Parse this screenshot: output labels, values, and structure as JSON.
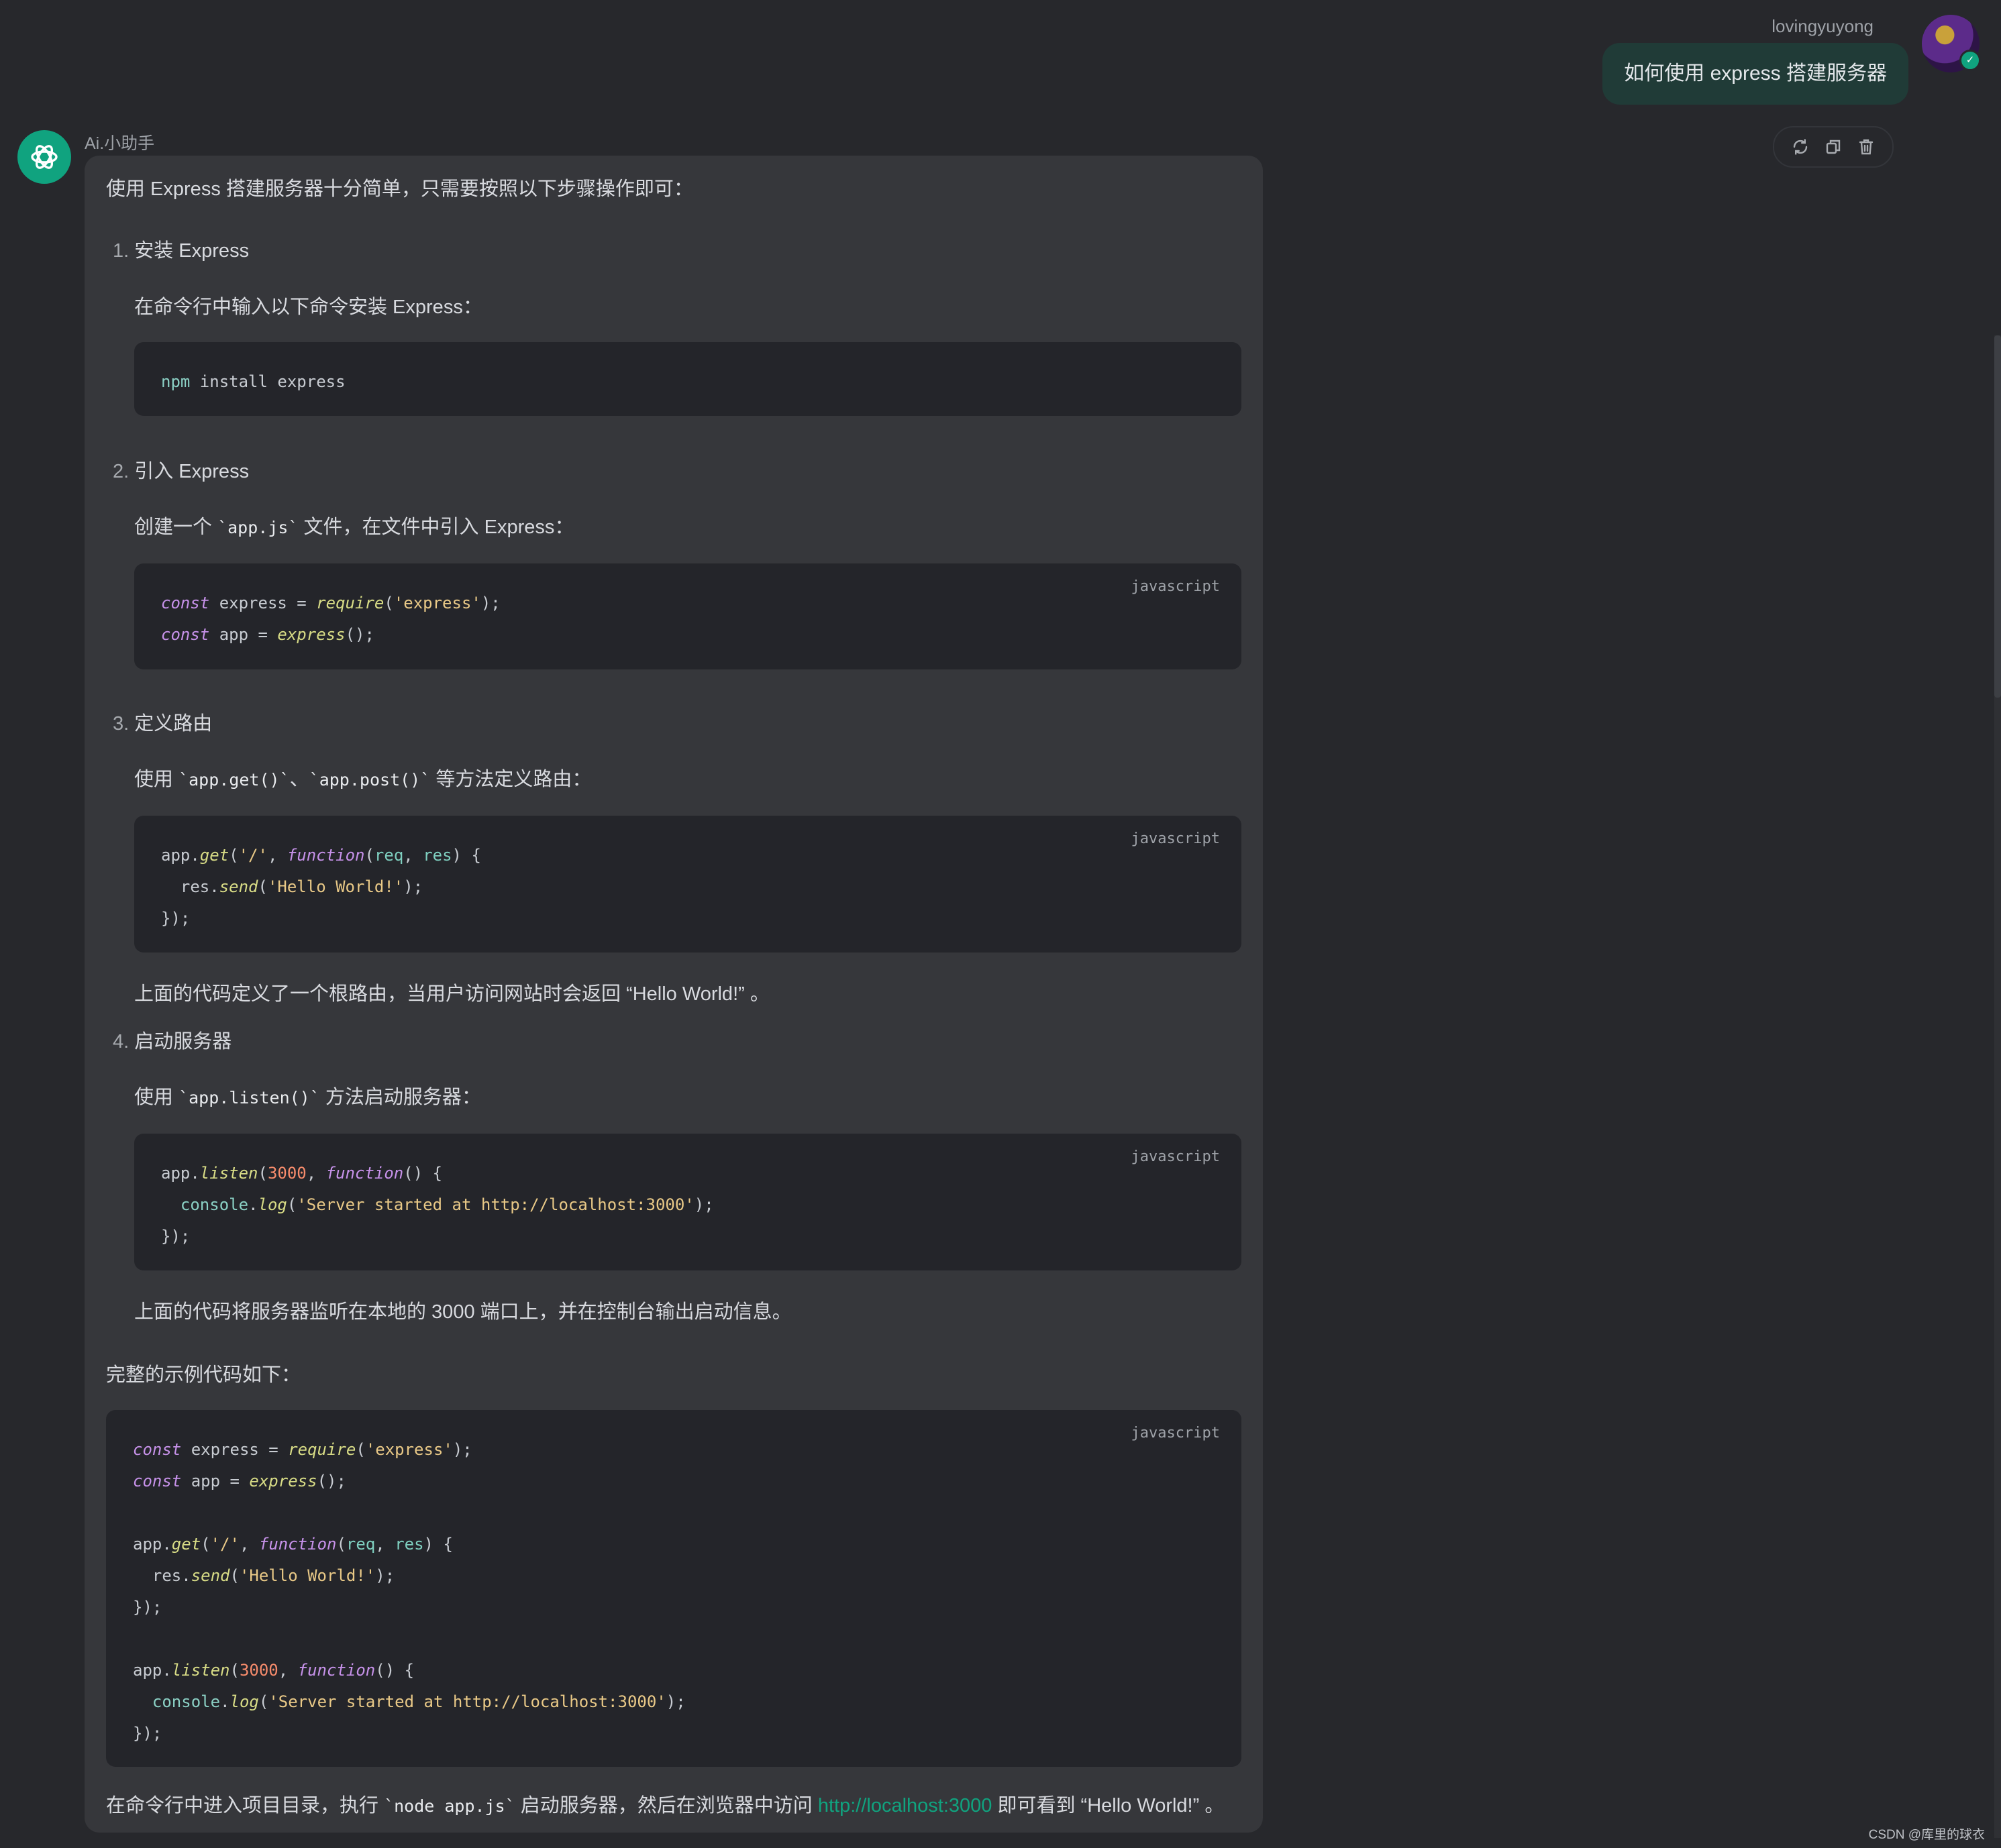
{
  "user": {
    "name": "lovingyuyong",
    "message": "如何使用 express 搭建服务器"
  },
  "assistant": {
    "name": "Ai.小助手",
    "actions": [
      "refresh-icon",
      "copy-icon",
      "delete-icon"
    ],
    "intro": "使用 Express 搭建服务器十分简单，只需要按照以下步骤操作即可：",
    "steps": [
      {
        "num": "1.",
        "title": "安装 Express",
        "desc": "在命令行中输入以下命令安装 Express：",
        "code": "npm install express"
      },
      {
        "num": "2.",
        "title": "引入 Express",
        "desc_pre": "创建一个 ",
        "desc_code": "`app.js`",
        "desc_post": " 文件，在文件中引入 Express：",
        "lang": "javascript"
      },
      {
        "num": "3.",
        "title": "定义路由",
        "desc_pre": "使用 ",
        "desc_code1": "`app.get()`",
        "desc_mid": "、",
        "desc_code2": "`app.post()`",
        "desc_post": " 等方法定义路由：",
        "lang": "javascript",
        "after": "上面的代码定义了一个根路由，当用户访问网站时会返回 “Hello World!” 。"
      },
      {
        "num": "4.",
        "title": "启动服务器",
        "desc_pre": "使用 ",
        "desc_code": "`app.listen()`",
        "desc_post": " 方法启动服务器：",
        "lang": "javascript",
        "after": "上面的代码将服务器监听在本地的 3000 端口上，并在控制台输出启动信息。"
      }
    ],
    "full_label": "完整的示例代码如下：",
    "full_lang": "javascript",
    "final_pre": "在命令行中进入项目目录，执行 ",
    "final_code": "`node app.js`",
    "final_mid": " 启动服务器，然后在浏览器中访问 ",
    "final_link": "http://localhost:3000",
    "final_post": " 即可看到 “Hello World!” 。"
  },
  "watermark": "CSDN @库里的球衣",
  "colors": {
    "accent": "#10a37f",
    "background": "#27282c",
    "bubble_user": "#203b37",
    "bubble_bot": "#36373b",
    "code_bg": "#24252a"
  }
}
